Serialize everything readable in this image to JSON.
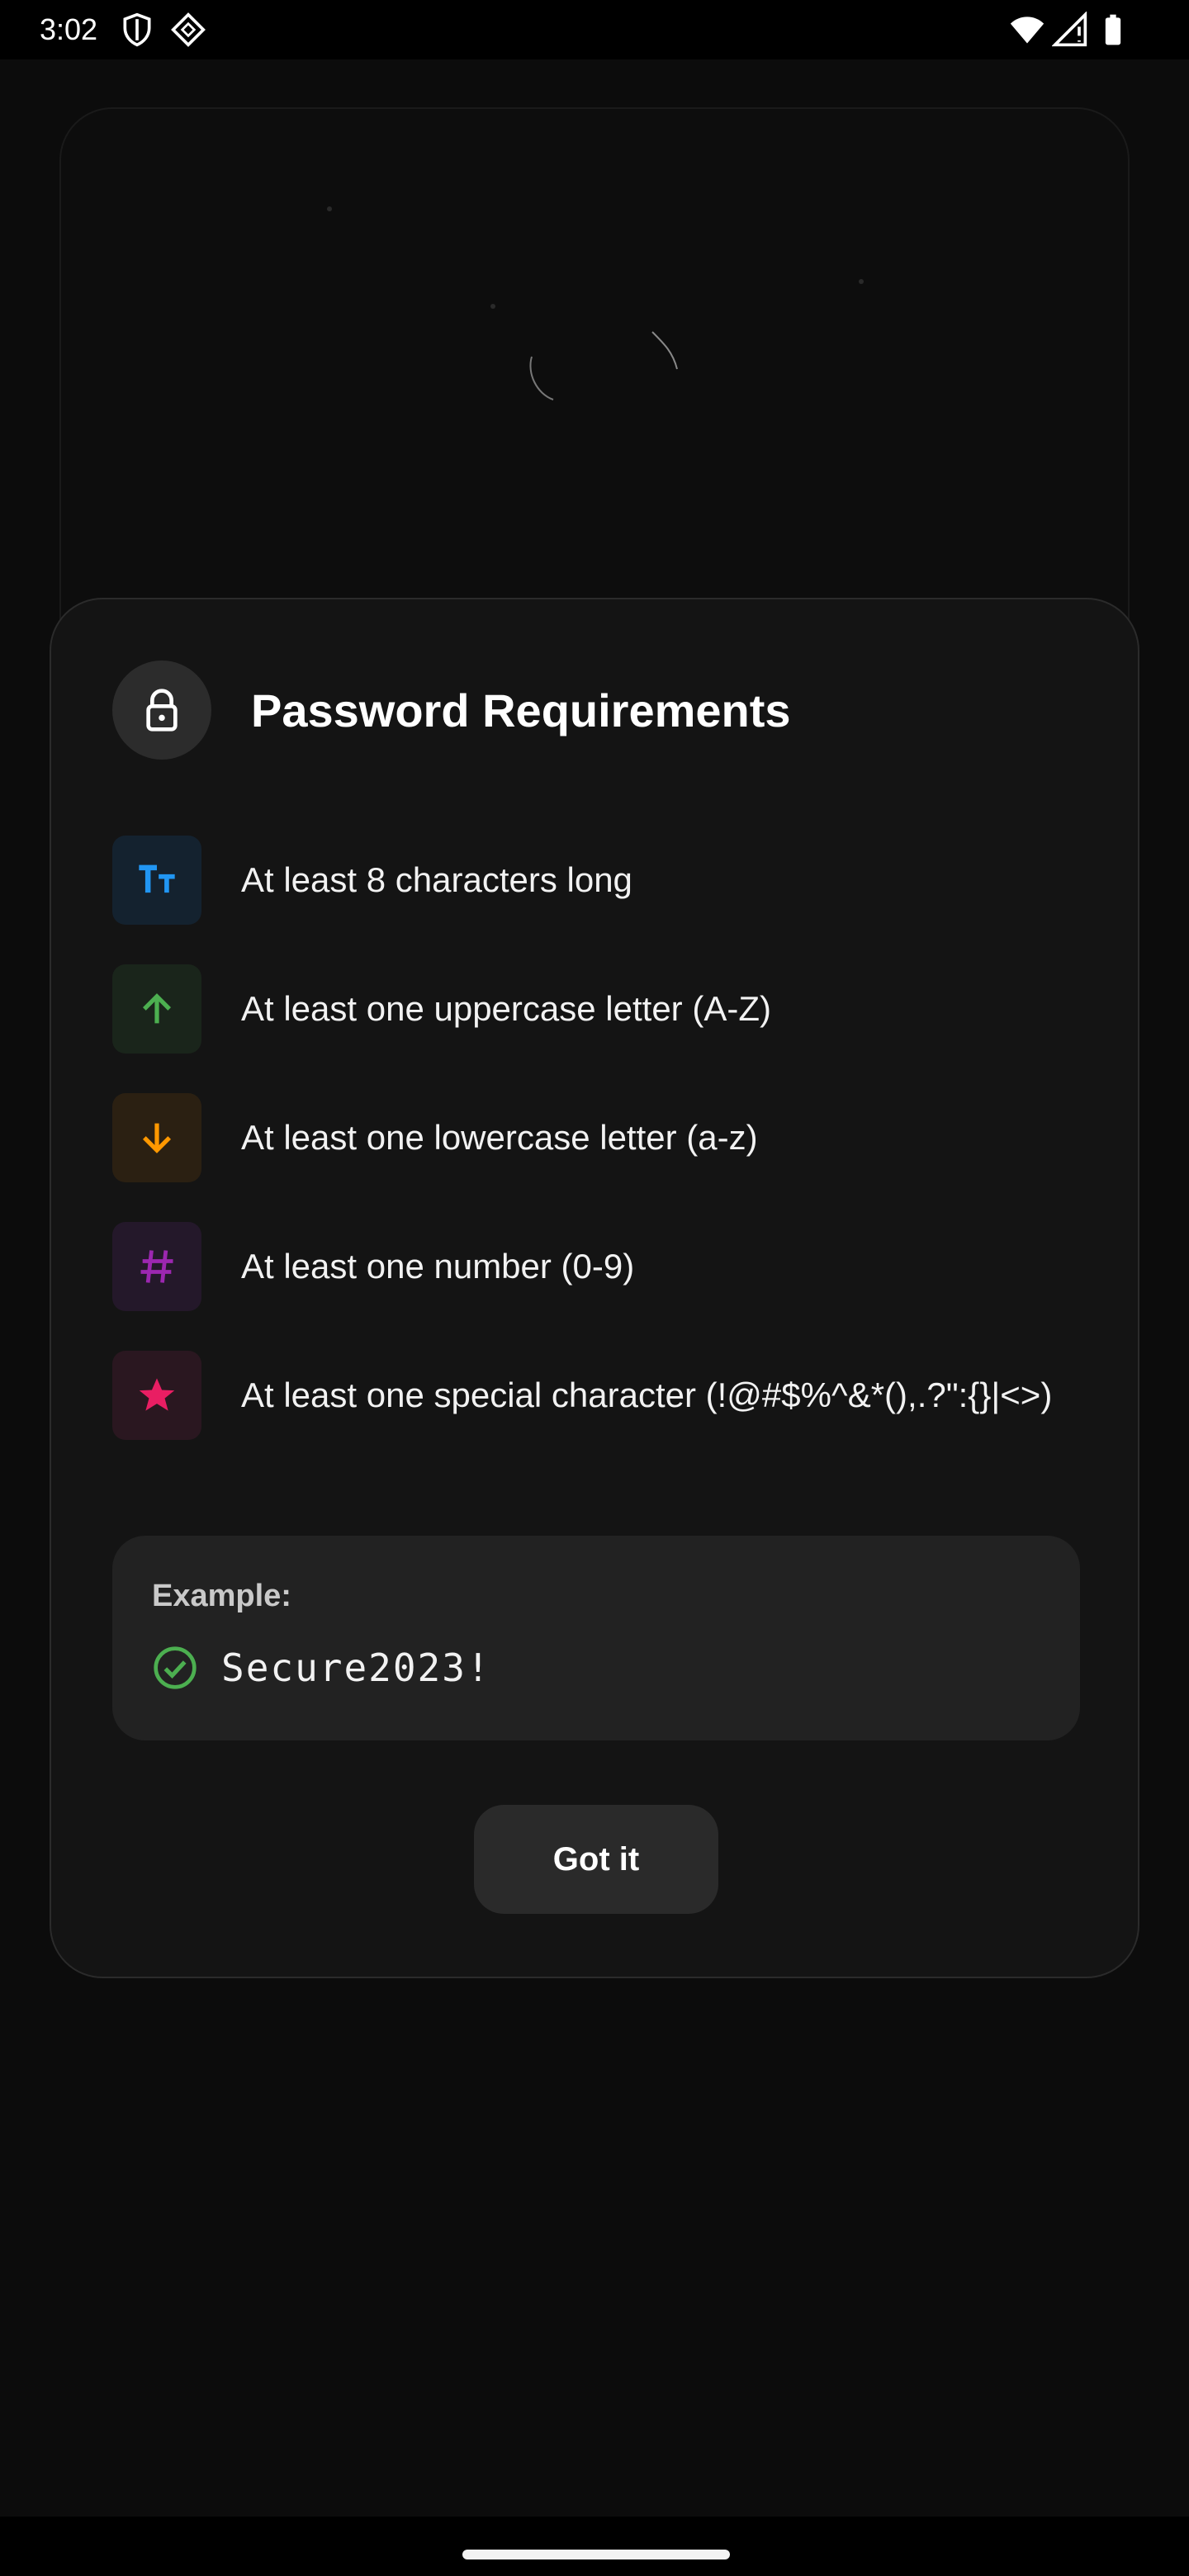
{
  "status_bar": {
    "time": "3:02",
    "icons": [
      "shield-icon",
      "diamond-icon",
      "wifi-icon",
      "signal-icon",
      "battery-icon"
    ]
  },
  "dialog": {
    "icon": "lock-icon",
    "title": "Password Requirements",
    "requirements": [
      {
        "icon": "text-size-icon",
        "text": "At least 8 characters long",
        "color": "#2196f3"
      },
      {
        "icon": "arrow-up-icon",
        "text": "At least one uppercase letter (A-Z)",
        "color": "#4caf50"
      },
      {
        "icon": "arrow-down-icon",
        "text": "At least one lowercase letter (a-z)",
        "color": "#ff9800"
      },
      {
        "icon": "hash-icon",
        "text": "At least one number (0-9)",
        "color": "#9c27b0"
      },
      {
        "icon": "star-icon",
        "text": "At least one special character (!@#$%^&*(),.?\":{}|<>)",
        "color": "#e91e63"
      }
    ],
    "example": {
      "label": "Example:",
      "value": "Secure2023!",
      "icon": "check-circle-icon"
    },
    "button_label": "Got it"
  }
}
